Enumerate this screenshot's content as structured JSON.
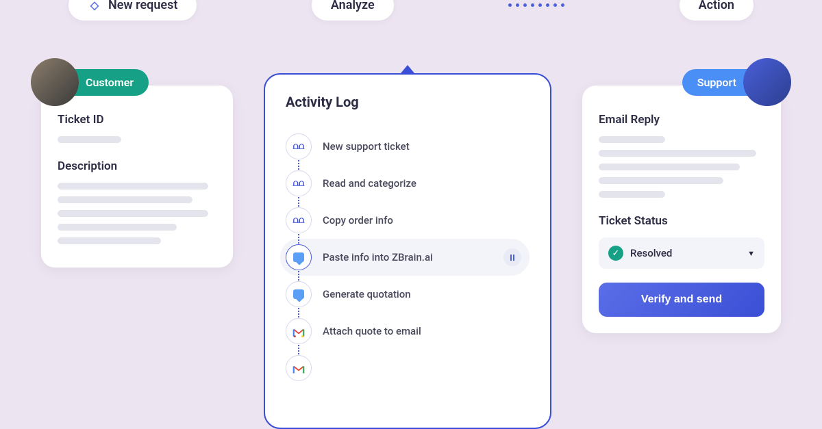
{
  "pills": {
    "new_request": "New request",
    "analyze": "Analyze",
    "action": "Action"
  },
  "customer": {
    "role": "Customer",
    "ticket_id_label": "Ticket ID",
    "description_label": "Description"
  },
  "activity": {
    "title": "Activity Log",
    "items": [
      {
        "label": "New support ticket",
        "icon": "zendesk"
      },
      {
        "label": "Read and categorize",
        "icon": "zendesk"
      },
      {
        "label": "Copy order info",
        "icon": "zendesk"
      },
      {
        "label": "Paste info into ZBrain.ai",
        "icon": "chat",
        "active": true
      },
      {
        "label": "Generate quotation",
        "icon": "chat"
      },
      {
        "label": "Attach quote to email",
        "icon": "gmail"
      }
    ]
  },
  "support": {
    "role": "Support",
    "email_reply_label": "Email Reply",
    "status_label": "Ticket Status",
    "status_value": "Resolved",
    "verify_button": "Verify and send"
  }
}
